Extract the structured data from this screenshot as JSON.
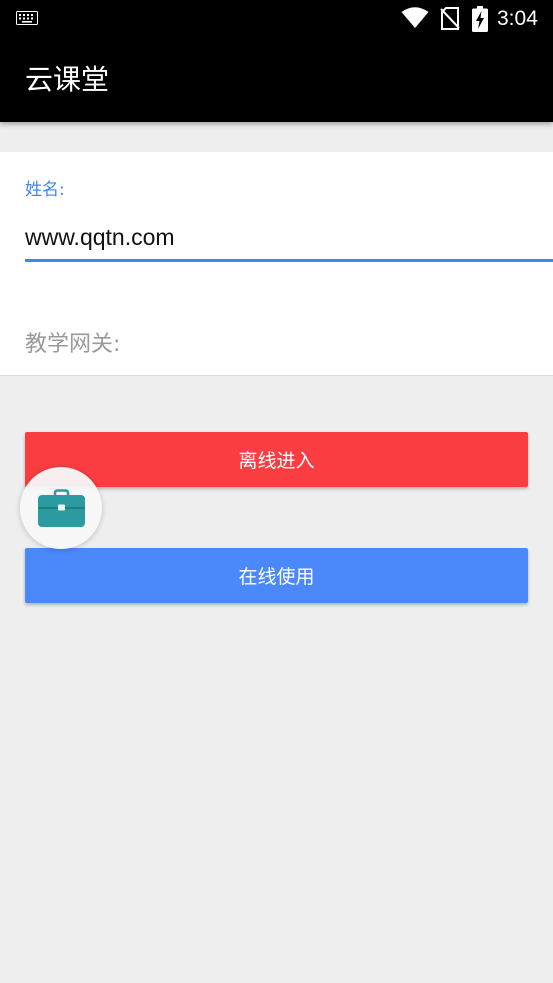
{
  "status_bar": {
    "time": "3:04",
    "icons": [
      "keyboard-icon",
      "wifi-icon",
      "no-sim-icon",
      "battery-charging-icon"
    ]
  },
  "app_bar": {
    "title": "云课堂"
  },
  "form": {
    "name_label": "姓名:",
    "name_value": "www.qqtn.com",
    "gateway_placeholder": "教学网关:"
  },
  "buttons": {
    "offline_label": "离线进入",
    "online_label": "在线使用"
  },
  "floating_ball": {
    "icon": "toolbox-icon"
  },
  "colors": {
    "accent_blue": "#3f87e8",
    "offline_button": "#f93d40",
    "online_button": "#4b89fb",
    "toolbar": "#000000",
    "background": "#eeeeee",
    "toolbox_teal": "#2a9ba0"
  }
}
